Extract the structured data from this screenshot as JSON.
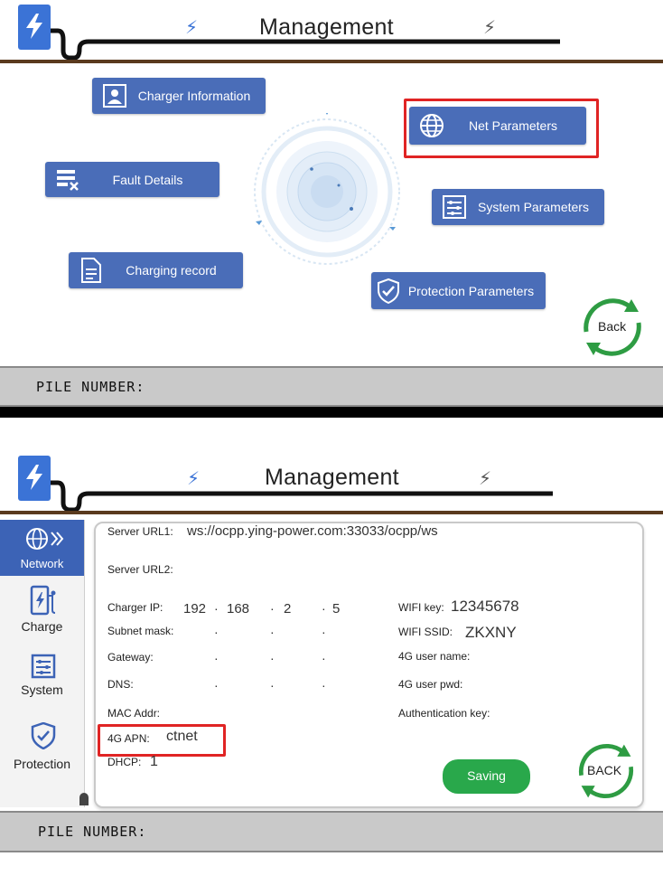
{
  "header": {
    "title": "Management"
  },
  "screen1": {
    "menu": {
      "charger_information": "Charger Information",
      "net_parameters": "Net Parameters",
      "fault_details": "Fault Details",
      "system_parameters": "System Parameters",
      "charging_record": "Charging record",
      "protection_parameters": "Protection Parameters"
    },
    "back_label": "Back",
    "pile_number_label": "PILE NUMBER:"
  },
  "screen2": {
    "sidebar": [
      {
        "label": "Network",
        "icon": "globe-icon",
        "active": true
      },
      {
        "label": "Charge",
        "icon": "charger-icon",
        "active": false
      },
      {
        "label": "System",
        "icon": "sliders-icon",
        "active": false
      },
      {
        "label": "Protection",
        "icon": "shield-check-icon",
        "active": false
      }
    ],
    "fields": {
      "server_url1_label": "Server URL1:",
      "server_url1_value": "ws://ocpp.ying-power.com:33033/ocpp/ws",
      "server_url2_label": "Server URL2:",
      "charger_ip_label": "Charger IP:",
      "charger_ip": [
        "192",
        "168",
        "2",
        "5"
      ],
      "subnet_mask_label": "Subnet mask:",
      "gateway_label": "Gateway:",
      "dns_label": "DNS:",
      "mac_addr_label": "MAC Addr:",
      "apn_label": "4G APN:",
      "apn_value": "ctnet",
      "dhcp_label": "DHCP:",
      "dhcp_value": "1",
      "wifi_key_label": "WIFI key:",
      "wifi_key_value": "12345678",
      "wifi_ssid_label": "WIFI SSID:",
      "wifi_ssid_value": "ZKXNY",
      "user_name_label": "4G user name:",
      "user_pwd_label": "4G user pwd:",
      "auth_key_label": "Authentication key:"
    },
    "saving_label": "Saving",
    "back_label": "BACK",
    "pile_number_label": "PILE NUMBER:"
  },
  "colors": {
    "button_blue": "#4a6db8",
    "highlight_red": "#e02424",
    "save_green": "#29a84b",
    "back_green": "#2e9c43",
    "header_brown": "#5a3a1e"
  }
}
